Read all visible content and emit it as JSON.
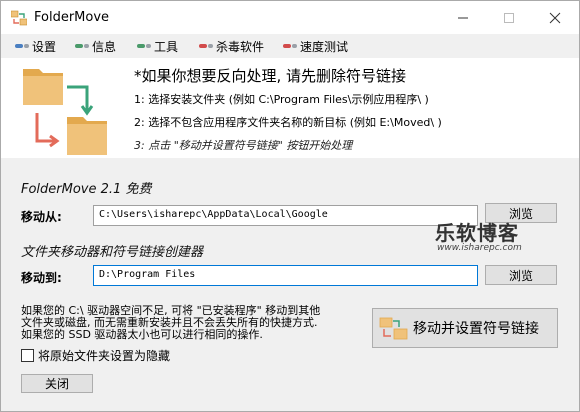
{
  "window": {
    "title": "FolderMove"
  },
  "menu": [
    {
      "label": "设置",
      "dot1": "#4a7fc1",
      "dot2": "#9aa0a8"
    },
    {
      "label": "信息",
      "dot1": "#4a9a6a",
      "dot2": "#9aa0a8"
    },
    {
      "label": "工具",
      "dot1": "#4a9a6a",
      "dot2": "#9aa0a8"
    },
    {
      "label": "杀毒软件",
      "dot1": "#d24b4b",
      "dot2": "#9aa0a8"
    },
    {
      "label": "速度测试",
      "dot1": "#d24b4b",
      "dot2": "#9aa0a8"
    }
  ],
  "intro": {
    "headline": "*如果你想要反向处理, 请先删除符号链接",
    "step1": "1: 选择安装文件夹 (例如 C:\\Program Files\\示例应用程序\\ )",
    "step2": "2: 选择不包含应用程序文件夹名称的新目标 (例如 E:\\Moved\\ )",
    "step3": "3: 点击 \"移动并设置符号链接\" 按钮开始处理"
  },
  "section1": "FolderMove 2.1 免费",
  "section2": "文件夹移动器和符号链接创建器",
  "from": {
    "label": "移动从:",
    "value": "C:\\Users\\isharepc\\AppData\\Local\\Google",
    "browse": "浏览"
  },
  "to": {
    "label": "移动到:",
    "value": "D:\\Program Files",
    "browse": "浏览"
  },
  "watermark": {
    "main": "乐软博客",
    "sub": "www.isharepc.com"
  },
  "info_lines": [
    "如果您的 C:\\ 驱动器空间不足, 可将 \"已安装程序\" 移动到其他",
    "文件夹或磁盘, 而无需重新安装并且不会丢失所有的快捷方式.",
    "如果您的 SSD 驱动器太小也可以进行相同的操作."
  ],
  "move_button": "移动并设置符号链接",
  "hide_checkbox": {
    "label": "将原始文件夹设置为隐藏",
    "checked": false
  },
  "close_button": "关闭",
  "colors": {
    "folder": "#f0c27a",
    "folder_dark": "#e3a94e",
    "arrow_green": "#3aa37a",
    "arrow_red": "#e36b5a"
  }
}
